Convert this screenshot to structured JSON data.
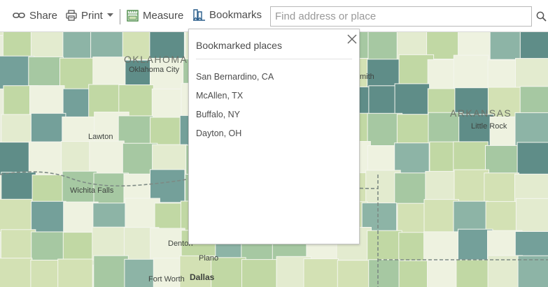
{
  "toolbar": {
    "share_label": "Share",
    "print_label": "Print",
    "measure_label": "Measure",
    "bookmarks_label": "Bookmarks"
  },
  "search": {
    "placeholder": "Find address or place"
  },
  "bookmarks_panel": {
    "title": "Bookmarked places",
    "items": [
      "San Bernardino, CA",
      "McAllen, TX",
      "Buffalo, NY",
      "Dayton, OH"
    ]
  },
  "map_labels": {
    "oklahoma": "OKLAHOMA",
    "oklahoma_city": "Oklahoma City",
    "arkansas": "ARKANSAS",
    "little_rock": "Little Rock",
    "lawton": "Lawton",
    "wichita_falls": "Wichita Falls",
    "denton": "Denton",
    "plano": "Plano",
    "fort_worth": "Fort Worth",
    "dallas": "Dallas",
    "smith": "mith"
  },
  "colors": {
    "accent": "#2b7ab8",
    "map_palette": [
      "#eef2e0",
      "#e3ebcf",
      "#d3e1b4",
      "#c1d8a4",
      "#a6c8a2",
      "#8db4a6",
      "#74a09a",
      "#5f8d88"
    ]
  }
}
